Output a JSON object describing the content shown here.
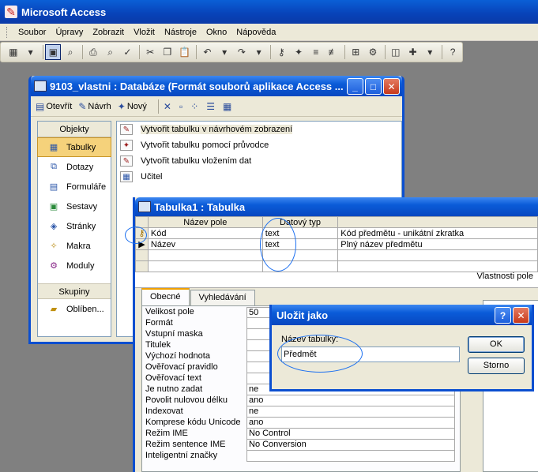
{
  "app": {
    "title": "Microsoft Access"
  },
  "menu": [
    "Soubor",
    "Úpravy",
    "Zobrazit",
    "Vložit",
    "Nástroje",
    "Okno",
    "Nápověda"
  ],
  "db_window": {
    "title": "9103_vlastni : Databáze (Formát souborů aplikace Access ...",
    "toolbar": {
      "open": "Otevřít",
      "design": "Návrh",
      "new": "Nový"
    },
    "objects_header": "Objekty",
    "objects": [
      "Tabulky",
      "Dotazy",
      "Formuláře",
      "Sestavy",
      "Stránky",
      "Makra",
      "Moduly"
    ],
    "groups_header": "Skupiny",
    "groups": [
      "Oblíben..."
    ],
    "list": [
      "Vytvořit tabulku v návrhovém zobrazení",
      "Vytvořit tabulku pomocí průvodce",
      "Vytvořit tabulku vložením dat",
      "Učitel"
    ]
  },
  "table_window": {
    "title": "Tabulka1 : Tabulka",
    "headers": {
      "field": "Název pole",
      "type": "Datový typ"
    },
    "rows": [
      {
        "field": "Kód",
        "type": "text",
        "desc": "Kód předmětu - unikátní zkratka"
      },
      {
        "field": "Název",
        "type": "text",
        "desc": "Plný název předmětu"
      }
    ],
    "properties_label": "Vlastnosti pole",
    "tabs": [
      "Obecné",
      "Vyhledávání"
    ],
    "props": [
      {
        "label": "Velikost pole",
        "value": "50"
      },
      {
        "label": "Formát",
        "value": ""
      },
      {
        "label": "Vstupní maska",
        "value": ""
      },
      {
        "label": "Titulek",
        "value": ""
      },
      {
        "label": "Výchozí hodnota",
        "value": ""
      },
      {
        "label": "Ověřovací pravidlo",
        "value": ""
      },
      {
        "label": "Ověřovací text",
        "value": ""
      },
      {
        "label": "Je nutno zadat",
        "value": "ne"
      },
      {
        "label": "Povolit nulovou délku",
        "value": "ano"
      },
      {
        "label": "Indexovat",
        "value": "ne"
      },
      {
        "label": "Komprese kódu Unicode",
        "value": "ano"
      },
      {
        "label": "Režim IME",
        "value": "No Control"
      },
      {
        "label": "Režim sentence IME",
        "value": "No Conversion"
      },
      {
        "label": "Inteligentní značky",
        "value": ""
      }
    ]
  },
  "dialog": {
    "title": "Uložit jako",
    "help": "?",
    "label": "Název tabulky:",
    "value": "Předmět",
    "ok": "OK",
    "cancel": "Storno"
  }
}
